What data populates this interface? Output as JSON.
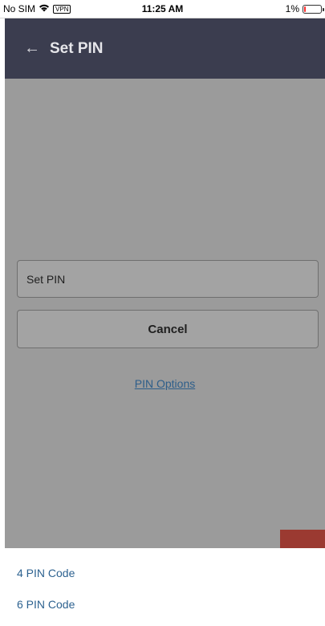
{
  "status_bar": {
    "carrier": "No SIM",
    "vpn": "VPN",
    "time": "11:25 AM",
    "battery": "1%",
    "battery_level": 0.01
  },
  "header": {
    "title": "Set PIN"
  },
  "form": {
    "pin_placeholder": "Set PIN",
    "cancel_label": "Cancel",
    "pin_options_label": "PIN Options"
  },
  "sheet": {
    "options": [
      {
        "label": "4 PIN Code"
      },
      {
        "label": "6 PIN Code"
      }
    ]
  },
  "colors": {
    "header_bg": "#3b3d4f",
    "overlay": "#9b9b9b",
    "link": "#2d6290",
    "battery_low": "#ff2d2d",
    "accent": "#9b3a31"
  }
}
